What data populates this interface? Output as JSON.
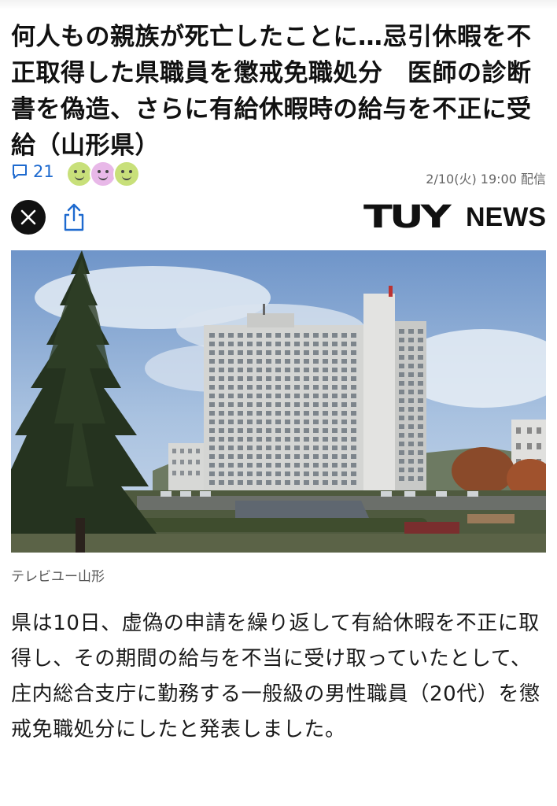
{
  "article": {
    "headline": "何人もの親族が死亡したことに…忌引休暇を不正取得した県職員を懲戒免職処分　医師の診断書を偽造、さらに有給休暇時の給与を不正に受給（山形県）",
    "comment_count": "21",
    "published": "2/10(火) 19:00 配信",
    "source_logo_mark": "TUY",
    "source_logo_word": "NEWS",
    "image_caption": "テレビユー山形",
    "body": "県は10日、虚偽の申請を繰り返して有給休暇を不正に取得し、その期間の給与を不当に受け取っていたとして、庄内総合支庁に勤務する一般級の男性職員（20代）を懲戒免職処分にしたと発表しました。"
  },
  "reactions": [
    {
      "icon": "smile-face-icon",
      "color": "#C8E07A"
    },
    {
      "icon": "smile-face-icon",
      "color": "#E8B8E8"
    },
    {
      "icon": "smile-face-icon",
      "color": "#C8E07A"
    }
  ],
  "colors": {
    "link": "#1E6ACF",
    "text": "#111111",
    "meta": "#666666"
  },
  "icons": {
    "comment": "comment-icon",
    "x": "x-logo-icon",
    "share": "share-icon"
  }
}
